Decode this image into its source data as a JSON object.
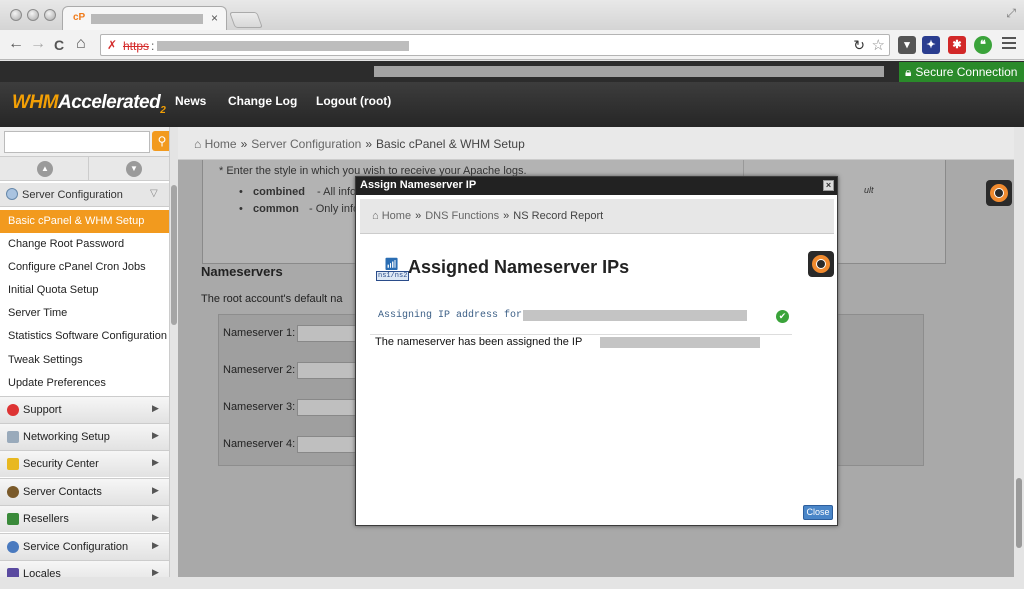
{
  "browser": {
    "tab_favicon": "cP",
    "tab_close": "×",
    "url_scheme": "https",
    "url_separator": ":",
    "nav_back": "←",
    "nav_forward": "→",
    "nav_reload": "C",
    "nav_home": "⌂",
    "omni_reload": "↻",
    "omni_star": "☆",
    "fullscreen": "⤢"
  },
  "topbar": {
    "secure_label": "Secure Connection"
  },
  "header": {
    "logo_whm": "WHM",
    "logo_accel": "Accelerated",
    "logo_sub": "2",
    "nav": [
      "News",
      "Change Log",
      "Logout (root)"
    ]
  },
  "sidebar": {
    "search_placeholder": "",
    "search_icon": "search-icon",
    "section_header": "Server Configuration",
    "items": [
      "Basic cPanel & WHM Setup",
      "Change Root Password",
      "Configure cPanel Cron Jobs",
      "Initial Quota Setup",
      "Server Time",
      "Statistics Software Configuration",
      "Tweak Settings",
      "Update Preferences"
    ],
    "active_item": "Basic cPanel & WHM Setup",
    "groups": [
      "Support",
      "Networking Setup",
      "Security Center",
      "Server Contacts",
      "Resellers",
      "Service Configuration",
      "Locales"
    ],
    "group_arrow": "▶"
  },
  "main": {
    "breadcrumb": [
      "Home",
      "Server Configuration",
      "Basic cPanel & WHM Setup"
    ],
    "breadcrumb_sep": "»",
    "enter_style_text": "* Enter the style in which you wish to receive your Apache logs.",
    "combined_label": "combined",
    "combined_text": "- All info",
    "common_label": "common",
    "common_text": "- Only info",
    "bullet": "•",
    "right_fragment": "ult",
    "nameservers_title": "Nameservers",
    "nameservers_desc": "The root account's default na",
    "nameserver_labels": [
      "Nameserver 1:",
      "Nameserver 2:",
      "Nameserver 3:",
      "Nameserver 4:"
    ]
  },
  "modal": {
    "title": "Assign Nameserver IP",
    "close_x": "×",
    "breadcrumb": [
      "Home",
      "DNS Functions",
      "NS Record Report"
    ],
    "heading": "Assigned Nameserver IPs",
    "icon_label": "ns1/ns2",
    "assigning_text": "Assigning IP address for",
    "check_glyph": "✔",
    "assigned_text": "The nameserver has been assigned the IP",
    "close_button": "Close"
  },
  "colors": {
    "accent_orange": "#f29a1e",
    "secure_green": "#2a8a2a",
    "header_dark": "#2c2c2c",
    "close_blue": "#4a86c8"
  }
}
